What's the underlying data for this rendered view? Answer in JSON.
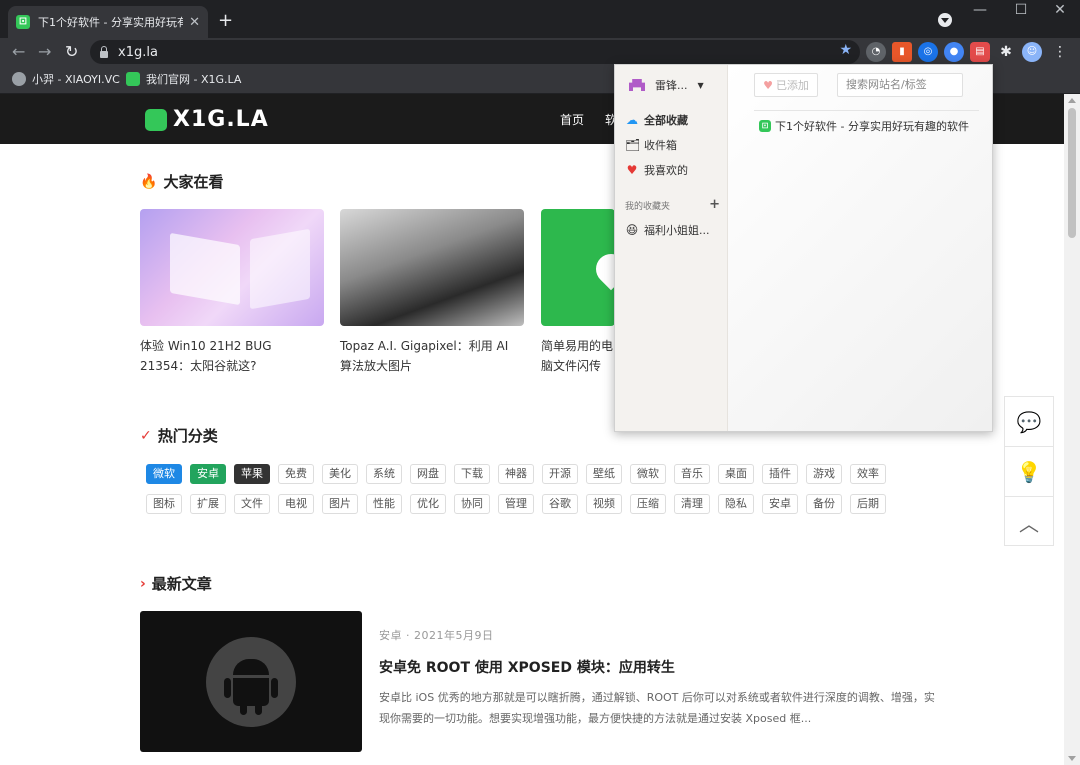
{
  "browser": {
    "tab_title": "下1个好软件 - 分享实用好玩有趣",
    "tab_close": "✕",
    "new_tab": "+",
    "window_controls": [
      "—",
      "☐",
      "✕"
    ],
    "url": "x1g.la",
    "back": "←",
    "forward": "→",
    "reload": "↻",
    "bookmarks": [
      {
        "label": "小羿 - XIAOYI.VC",
        "icon": "avatar-icon"
      },
      {
        "label": "我们官网 - X1G.LA",
        "icon": "x1g-favicon"
      }
    ]
  },
  "site": {
    "logo_text": "X1G.LA",
    "nav": [
      "首页",
      "软"
    ],
    "hot_section": {
      "title": "大家在看",
      "icon": "fire-icon",
      "cards": [
        {
          "title": "体验 Win10 21H2 BUG 21354：太阳谷就这?"
        },
        {
          "title": "Topaz A.I. Gigapixel：利用 AI 算法放大图片"
        },
        {
          "title": "简单易用的电脑文件闪传"
        }
      ]
    },
    "categories": {
      "title": "热门分类",
      "row1": [
        "微软",
        "安卓",
        "苹果",
        "免费",
        "美化",
        "系统",
        "网盘",
        "下载",
        "神器",
        "开源",
        "壁纸",
        "微软",
        "音乐",
        "桌面",
        "插件",
        "游戏",
        "效率"
      ],
      "row2": [
        "图标",
        "扩展",
        "文件",
        "电视",
        "图片",
        "性能",
        "优化",
        "协同",
        "管理",
        "谷歌",
        "视频",
        "压缩",
        "清理",
        "隐私",
        "安卓",
        "备份",
        "后期"
      ]
    },
    "latest": {
      "title": "最新文章",
      "article": {
        "category": "安卓",
        "date": "2021年5月9日",
        "meta": "安卓 · 2021年5月9日",
        "title": "安卓免 ROOT 使用 XPOSED 模块：应用转生",
        "excerpt": "安卓比 iOS 优秀的地方那就是可以瞎折腾，通过解锁、ROOT 后你可以对系统或者软件进行深度的调教、增强，实现你需要的一切功能。想要实现增强功能，最方便快捷的方法就是通过安装 Xposed 框..."
      }
    }
  },
  "popup": {
    "user": "雷锋...",
    "menu": [
      {
        "label": "全部收藏",
        "icon": "cloud-icon"
      },
      {
        "label": "收件箱",
        "icon": "inbox-icon"
      },
      {
        "label": "我喜欢的",
        "icon": "heart-icon"
      }
    ],
    "folders_heading": "我的收藏夹",
    "folders": [
      {
        "label": "福利小姐姐...",
        "icon": "laugh-emoji-icon"
      }
    ],
    "added_label": "已添加",
    "search_placeholder": "搜索网站名/标签",
    "links": [
      {
        "label": "下1个好软件 - 分享实用好玩有趣的软件"
      }
    ]
  }
}
